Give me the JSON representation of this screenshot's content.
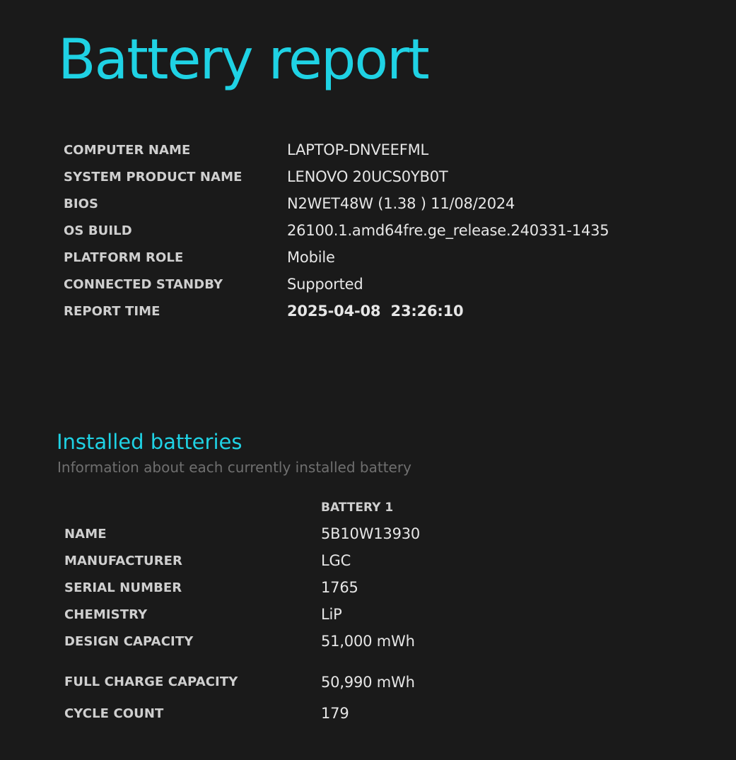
{
  "page": {
    "title": "Battery report"
  },
  "system_info": [
    {
      "label": "COMPUTER NAME",
      "value": "LAPTOP-DNVEEFML"
    },
    {
      "label": "SYSTEM PRODUCT NAME",
      "value": "LENOVO 20UCS0YB0T"
    },
    {
      "label": "BIOS",
      "value": "N2WET48W (1.38 ) 11/08/2024"
    },
    {
      "label": "OS BUILD",
      "value": "26100.1.amd64fre.ge_release.240331-1435"
    },
    {
      "label": "PLATFORM ROLE",
      "value": "Mobile"
    },
    {
      "label": "CONNECTED STANDBY",
      "value": "Supported"
    },
    {
      "label": "REPORT TIME",
      "value": "2025-04-08  23:26:10"
    }
  ],
  "installed_batteries": {
    "title": "Installed batteries",
    "description": "Information about each currently installed battery",
    "column_header": "BATTERY 1",
    "rows": [
      {
        "label": "NAME",
        "value": "5B10W13930"
      },
      {
        "label": "MANUFACTURER",
        "value": "LGC"
      },
      {
        "label": "SERIAL NUMBER",
        "value": "1765"
      },
      {
        "label": "CHEMISTRY",
        "value": "LiP"
      },
      {
        "label": "DESIGN CAPACITY",
        "value": "51,000 mWh"
      },
      {
        "label": "FULL CHARGE CAPACITY",
        "value": "50,990 mWh"
      },
      {
        "label": "CYCLE COUNT",
        "value": "179"
      }
    ]
  },
  "colors": {
    "background": "#1a1a1a",
    "accent": "#1fd2e4",
    "label_text": "#cfcfcf",
    "value_text": "#e6e6e6",
    "description_text": "#6f6f6f"
  }
}
